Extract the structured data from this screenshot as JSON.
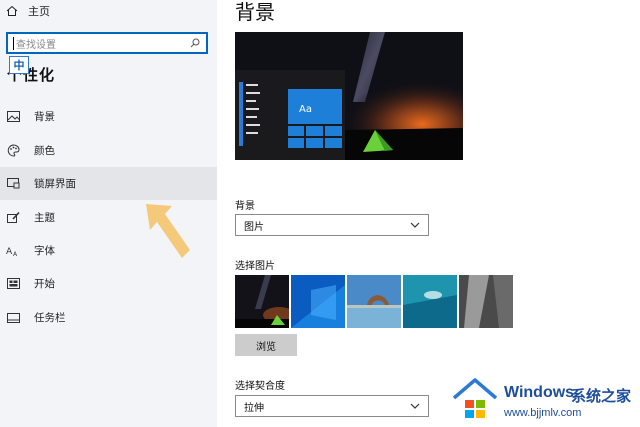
{
  "sidebar": {
    "home_label": "主页",
    "search_placeholder": "查找设置",
    "ime_label": "中",
    "section_title": "个性化",
    "items": [
      {
        "label": "背景",
        "icon": "image-icon"
      },
      {
        "label": "颜色",
        "icon": "palette-icon"
      },
      {
        "label": "锁屏界面",
        "icon": "lock-screen-icon",
        "active": true
      },
      {
        "label": "主题",
        "icon": "brush-icon"
      },
      {
        "label": "字体",
        "icon": "font-icon"
      },
      {
        "label": "开始",
        "icon": "start-icon"
      },
      {
        "label": "任务栏",
        "icon": "taskbar-icon"
      }
    ]
  },
  "main": {
    "title": "背景",
    "preview_tile_label": "Aa",
    "background_label": "背景",
    "background_value": "图片",
    "choose_picture_label": "选择图片",
    "browse_label": "浏览",
    "fit_label": "选择契合度",
    "fit_value": "拉伸"
  },
  "watermark": {
    "brand": "Windows",
    "brand_cn": "系统之家",
    "url": "www.bjjmlv.com"
  },
  "colors": {
    "accent": "#0067c0",
    "sidebar_bg": "#f2f4f7",
    "active_item_bg": "#e3e5e8",
    "tile_blue": "#1e7fd8",
    "arrow": "#f4c46b"
  }
}
